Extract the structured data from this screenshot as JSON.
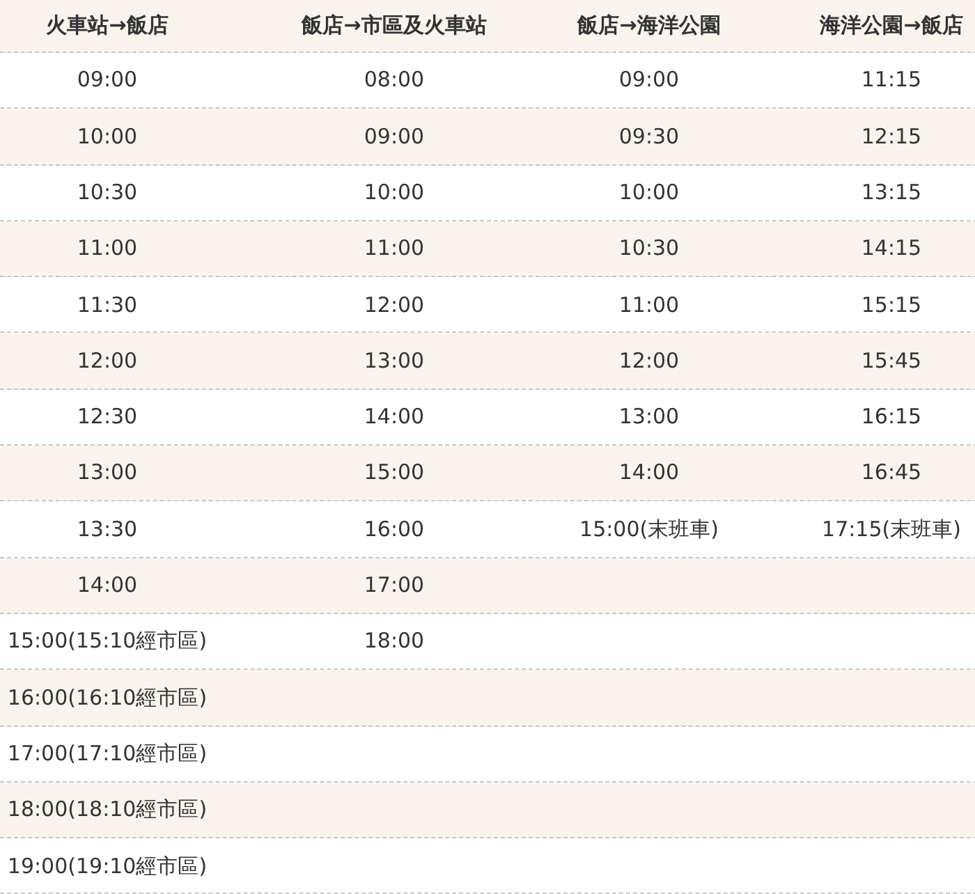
{
  "table": {
    "columns": [
      "火車站→飯店",
      "飯店→市區及火車站",
      "飯店→海洋公園",
      "海洋公園→飯店"
    ],
    "rows": [
      {
        "cells": [
          "09:00",
          "08:00",
          "09:00",
          "11:15"
        ]
      },
      {
        "cells": [
          "10:00",
          "09:00",
          "09:30",
          "12:15"
        ]
      },
      {
        "cells": [
          "10:30",
          "10:00",
          "10:00",
          "13:15"
        ]
      },
      {
        "cells": [
          "11:00",
          "11:00",
          "10:30",
          "14:15"
        ]
      },
      {
        "cells": [
          "11:30",
          "12:00",
          "11:00",
          "15:15"
        ]
      },
      {
        "cells": [
          "12:00",
          "13:00",
          "12:00",
          "15:45"
        ]
      },
      {
        "cells": [
          "12:30",
          "14:00",
          "13:00",
          "16:15"
        ]
      },
      {
        "cells": [
          "13:00",
          "15:00",
          "14:00",
          "16:45"
        ]
      },
      {
        "cells": [
          "13:30",
          "16:00",
          "15:00(末班車)",
          "17:15(末班車)"
        ]
      },
      {
        "cells": [
          "14:00",
          "17:00",
          null,
          null
        ]
      },
      {
        "cells": [
          "15:00(15:10經市區)",
          "18:00",
          null,
          null
        ]
      },
      {
        "cells": [
          "16:00(16:10經市區)",
          null,
          null,
          null
        ]
      },
      {
        "cells": [
          "17:00(17:10經市區)",
          null,
          null,
          null
        ]
      },
      {
        "cells": [
          "18:00(18:10經市區)",
          null,
          null,
          null
        ]
      },
      {
        "cells": [
          "19:00(19:10經市區)",
          null,
          null,
          null
        ]
      }
    ]
  }
}
